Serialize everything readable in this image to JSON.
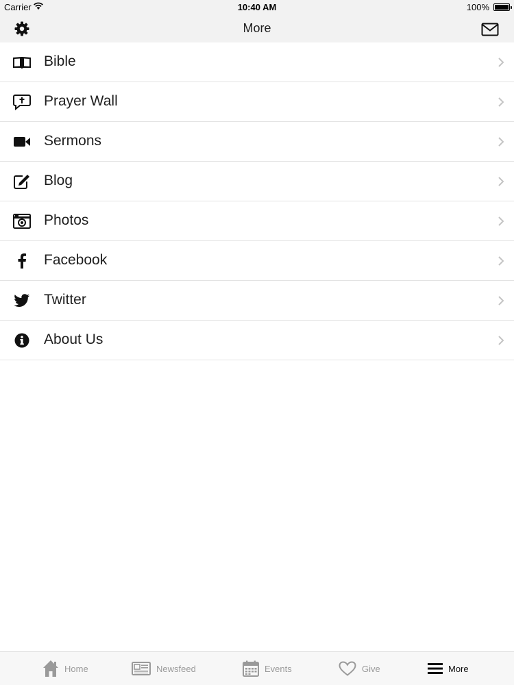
{
  "status_bar": {
    "carrier": "Carrier",
    "time": "10:40 AM",
    "battery": "100%"
  },
  "nav": {
    "title": "More",
    "left_icon": "gear-icon",
    "right_icon": "mail-icon"
  },
  "menu": {
    "items": [
      {
        "label": "Bible",
        "icon": "bible-icon"
      },
      {
        "label": "Prayer Wall",
        "icon": "prayer-icon"
      },
      {
        "label": "Sermons",
        "icon": "video-camera-icon"
      },
      {
        "label": "Blog",
        "icon": "edit-icon"
      },
      {
        "label": "Photos",
        "icon": "camera-icon"
      },
      {
        "label": "Facebook",
        "icon": "facebook-icon"
      },
      {
        "label": "Twitter",
        "icon": "twitter-icon"
      },
      {
        "label": "About Us",
        "icon": "info-icon"
      }
    ]
  },
  "tab_bar": {
    "tabs": [
      {
        "label": "Home",
        "icon": "home-icon"
      },
      {
        "label": "Newsfeed",
        "icon": "newspaper-icon"
      },
      {
        "label": "Events",
        "icon": "calendar-icon"
      },
      {
        "label": "Give",
        "icon": "heart-icon"
      },
      {
        "label": "More",
        "icon": "menu-icon",
        "active": true
      }
    ]
  },
  "colors": {
    "bar_bg": "#f2f2f2",
    "active_tab": "#111111",
    "inactive_tab": "#9a9a9a",
    "separator": "#e3e3e3"
  }
}
